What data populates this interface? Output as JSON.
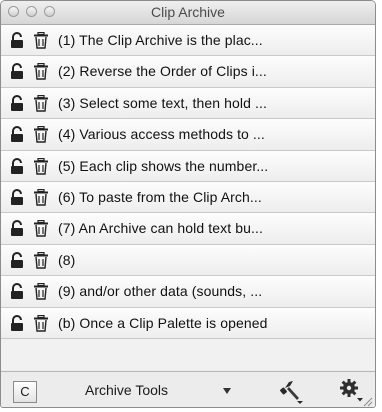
{
  "window": {
    "title": "Clip Archive"
  },
  "clips": [
    {
      "label": "(1)  The Clip Archive is the plac..."
    },
    {
      "label": "(2)  Reverse the Order of Clips i..."
    },
    {
      "label": "(3)  Select some text, then hold ..."
    },
    {
      "label": "(4)  Various access methods to ..."
    },
    {
      "label": "(5)  Each clip shows the number..."
    },
    {
      "label": "(6)  To paste from the Clip Arch..."
    },
    {
      "label": "(7)  An Archive can hold text bu..."
    },
    {
      "label": "(8)"
    },
    {
      "label": "(9)  and/or other data (sounds, ..."
    },
    {
      "label": "(b)  Once a Clip Palette is opened"
    }
  ],
  "toolbar": {
    "c_button": "C",
    "tools_menu": "Archive Tools"
  },
  "icons": {
    "row_lock": "lock-icon",
    "row_delete": "trash-icon",
    "tools_dropdown": "triangle-down-icon",
    "hammer": "hammer-icon",
    "gear": "gear-icon",
    "resize": "resize-grip-icon"
  },
  "colors": {
    "title_text": "#4b4b4b",
    "row_text": "#111111",
    "window_bg": "#ececec"
  }
}
